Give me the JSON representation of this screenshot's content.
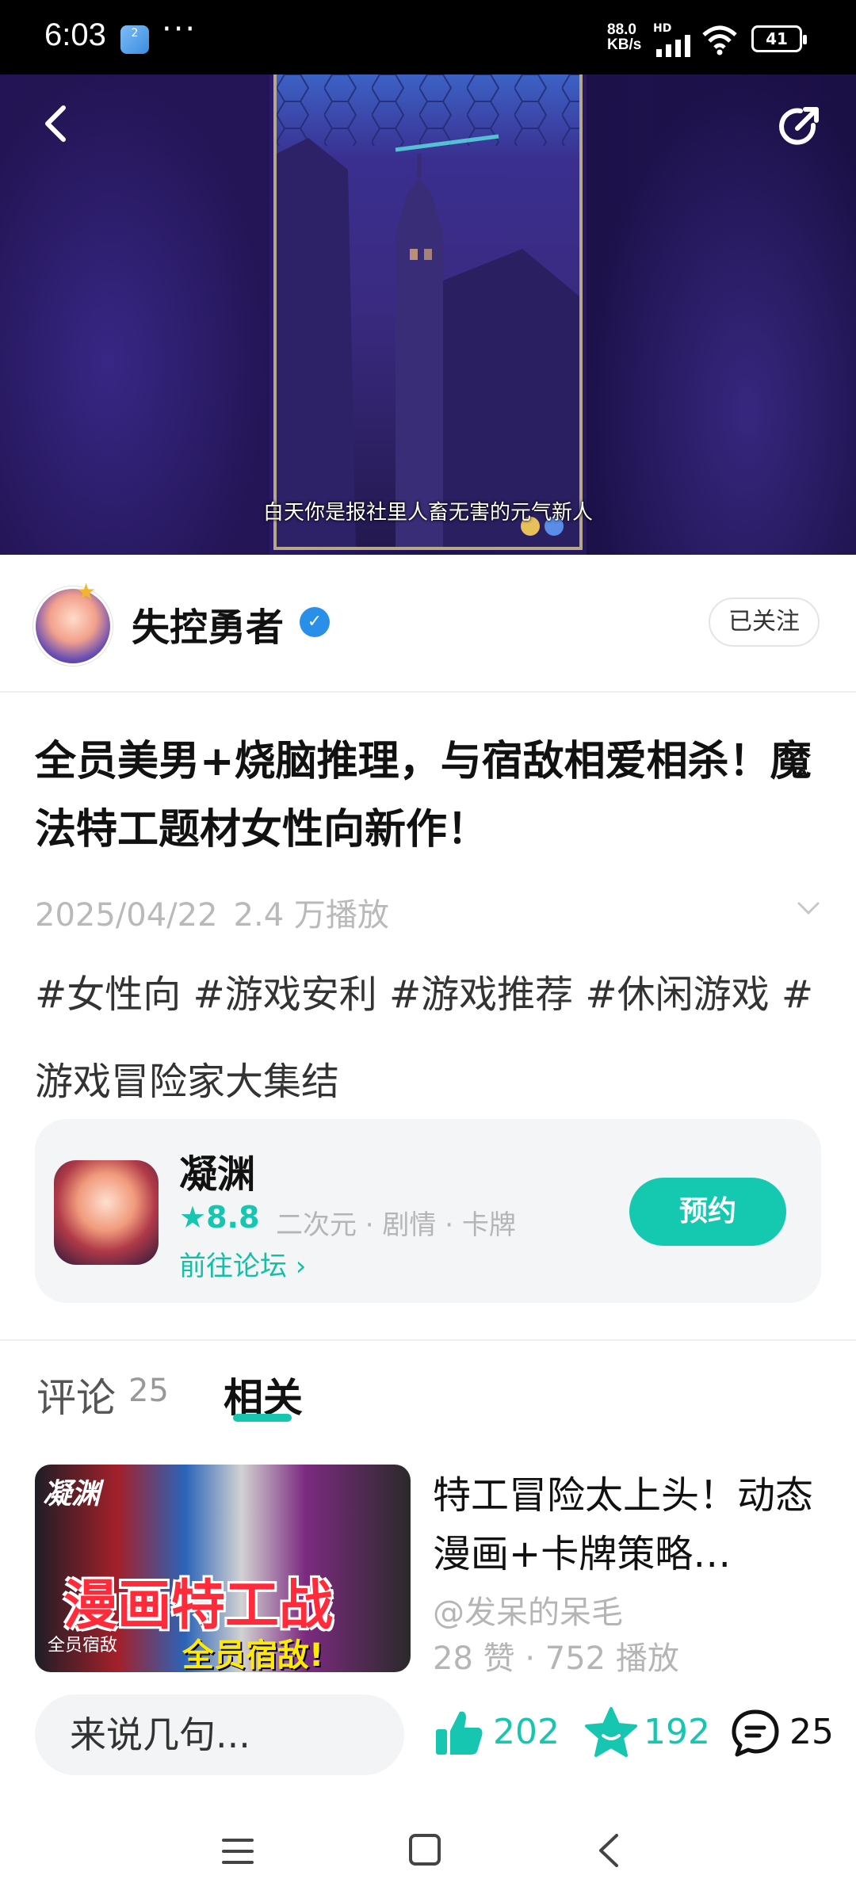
{
  "status_bar": {
    "time": "6:03",
    "notif_badge": "2",
    "more": "···",
    "speed_value": "88.0",
    "speed_unit": "KB/s",
    "hd": "HD",
    "battery": "41"
  },
  "video": {
    "subtitle": "白天你是报社里人畜无害的元气新人"
  },
  "author": {
    "name": "失控勇者",
    "follow_label": "已关注"
  },
  "post": {
    "title": "全员美男+烧脑推理，与宿敌相爱相杀！魔法特工题材女性向新作！",
    "date": "2025/04/22",
    "views": "2.4 万播放",
    "tags": "#女性向 #游戏安利 #游戏推荐 #休闲游戏 #游戏冒险家大集结"
  },
  "game": {
    "name": "凝渊",
    "rating": "★8.8",
    "genres": "二次元 · 剧情 · 卡牌",
    "forum_link": "前往论坛 ›",
    "reserve_label": "预约"
  },
  "tabs": {
    "comments_label": "评论",
    "comments_count": "25",
    "related_label": "相关"
  },
  "related": [
    {
      "thumb_logo": "凝渊",
      "thumb_big": "漫画特工战",
      "thumb_tag": "全员宿敌!",
      "thumb_small": "全员宿敌",
      "title": "特工冒险太上头！动态漫画+卡牌策略…",
      "author": "@发呆的呆毛",
      "stats": "28 赞 · 752 播放"
    }
  ],
  "bottom_bar": {
    "input_placeholder": "来说几句...",
    "likes": "202",
    "favorites": "192",
    "comments": "25"
  },
  "colors": {
    "accent": "#16c6b0",
    "verified": "#2a8fe8"
  },
  "icons": [
    "back-icon",
    "share-icon",
    "verified-icon",
    "star-icon",
    "chevron-down-icon",
    "like-icon",
    "favorite-icon",
    "comment-icon",
    "menu-icon",
    "home-icon",
    "nav-back-icon"
  ]
}
